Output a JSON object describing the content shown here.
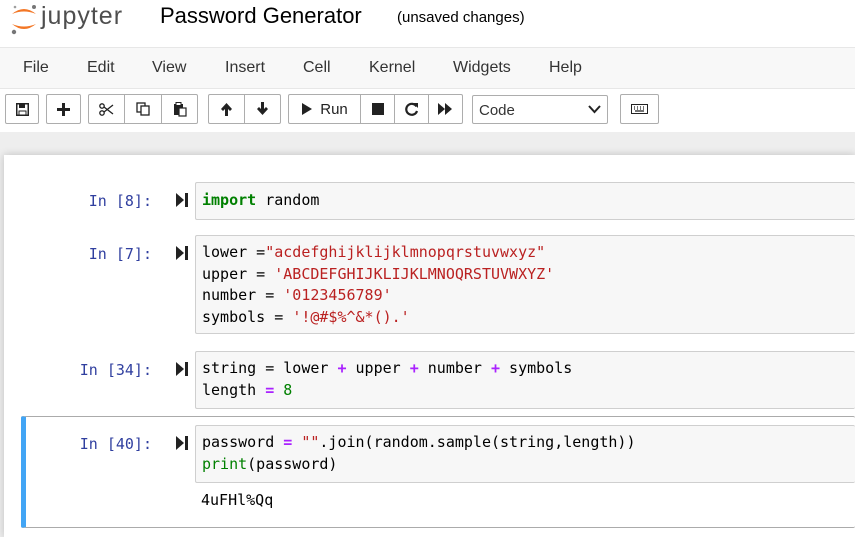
{
  "app": {
    "name": "jupyter",
    "notebook_title": "Password Generator",
    "save_status": "(unsaved changes)"
  },
  "colors": {
    "logo_orange": "#f37726",
    "prompt_blue": "#303f9f",
    "selected_border": "#42a5f5"
  },
  "menu": [
    "File",
    "Edit",
    "View",
    "Insert",
    "Cell",
    "Kernel",
    "Widgets",
    "Help"
  ],
  "toolbar": {
    "run_label": "Run",
    "cell_type": "Code"
  },
  "cells": [
    {
      "prompt": "In [8]:",
      "lines": [
        "import random"
      ]
    },
    {
      "prompt": "In [7]:",
      "lines": [
        "lower =\"acdefghijklijklmnopqrstuvwxyz\"",
        "upper = 'ABCDEFGHIJKLIJKLMNOQRSTUVWXYZ'",
        "number = '0123456789'",
        "symbols = '!@#$%^&*().'"
      ]
    },
    {
      "prompt": "In [34]:",
      "lines": [
        "string = lower + upper + number + symbols",
        "length = 8"
      ]
    },
    {
      "prompt": "In [40]:",
      "lines": [
        "password = \"\".join(random.sample(string,length))",
        "print(password)"
      ],
      "output": "4uFHl%Qq"
    }
  ]
}
